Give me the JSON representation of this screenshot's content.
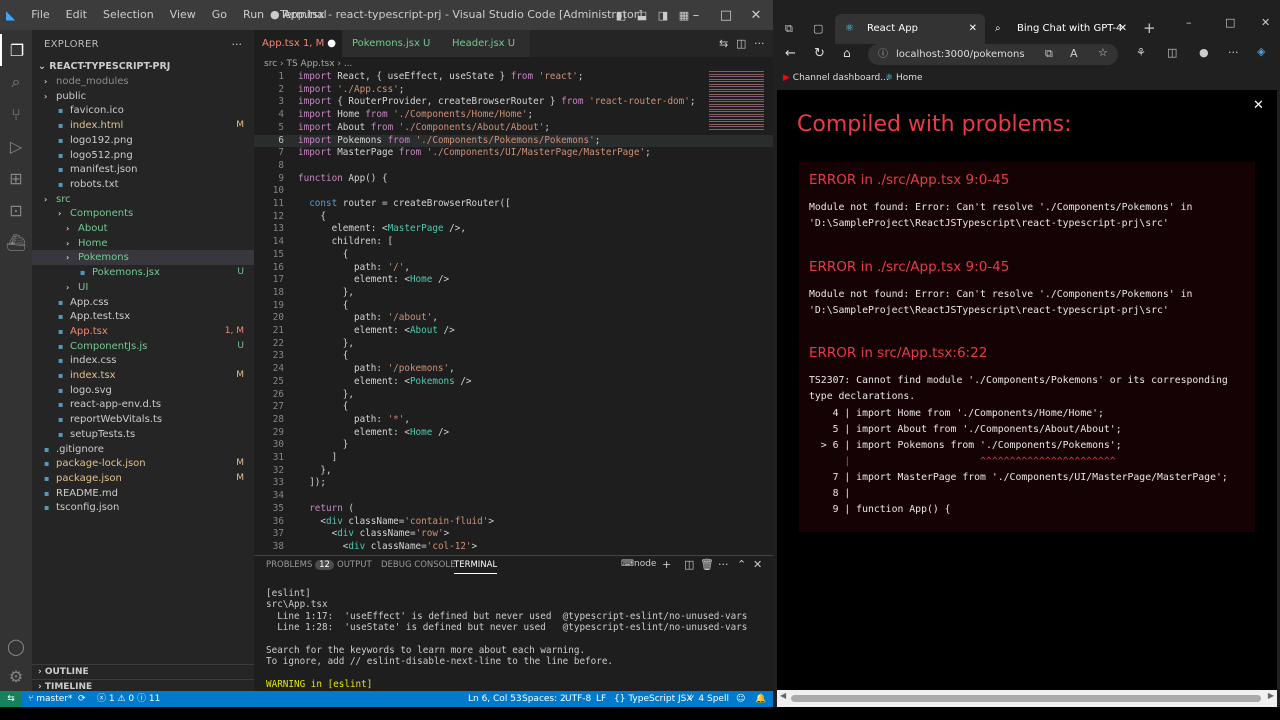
{
  "vscode": {
    "menu": [
      "File",
      "Edit",
      "Selection",
      "View",
      "Go",
      "Run",
      "Terminal"
    ],
    "window_title": "● App.tsx - react-typescript-prj - Visual Studio Code [Administrator]",
    "explorer_title": "EXPLORER",
    "project": "REACT-TYPESCRIPT-PRJ",
    "tree": [
      {
        "name": "node_modules",
        "badge": "",
        "color": "#8c8c8c",
        "kind": "folder"
      },
      {
        "name": "public",
        "badge": "",
        "color": "#ccc",
        "kind": "folder"
      },
      {
        "name": "favicon.ico",
        "badge": "",
        "color": "#ccc",
        "kind": "file"
      },
      {
        "name": "index.html",
        "badge": "M",
        "color": "#e2c08d",
        "kind": "file"
      },
      {
        "name": "logo192.png",
        "badge": "",
        "color": "#ccc",
        "kind": "file"
      },
      {
        "name": "logo512.png",
        "badge": "",
        "color": "#ccc",
        "kind": "file"
      },
      {
        "name": "manifest.json",
        "badge": "",
        "color": "#ccc",
        "kind": "file"
      },
      {
        "name": "robots.txt",
        "badge": "",
        "color": "#ccc",
        "kind": "file"
      },
      {
        "name": "src",
        "badge": "",
        "color": "#73c991",
        "kind": "folder"
      },
      {
        "name": "Components",
        "badge": "",
        "color": "#73c991",
        "kind": "folder"
      },
      {
        "name": "About",
        "badge": "",
        "color": "#73c991",
        "kind": "folder"
      },
      {
        "name": "Home",
        "badge": "",
        "color": "#73c991",
        "kind": "folder"
      },
      {
        "name": "Pokemons",
        "badge": "",
        "color": "#73c991",
        "kind": "folder"
      },
      {
        "name": "Pokemons.jsx",
        "badge": "U",
        "color": "#73c991",
        "kind": "file"
      },
      {
        "name": "UI",
        "badge": "",
        "color": "#73c991",
        "kind": "folder"
      },
      {
        "name": "App.css",
        "badge": "",
        "color": "#ccc",
        "kind": "file"
      },
      {
        "name": "App.test.tsx",
        "badge": "",
        "color": "#ccc",
        "kind": "file"
      },
      {
        "name": "App.tsx",
        "badge": "1, M",
        "color": "#f48771",
        "kind": "file"
      },
      {
        "name": "ComponentJs.js",
        "badge": "U",
        "color": "#73c991",
        "kind": "file"
      },
      {
        "name": "index.css",
        "badge": "",
        "color": "#ccc",
        "kind": "file"
      },
      {
        "name": "index.tsx",
        "badge": "M",
        "color": "#e2c08d",
        "kind": "file"
      },
      {
        "name": "logo.svg",
        "badge": "",
        "color": "#ccc",
        "kind": "file"
      },
      {
        "name": "react-app-env.d.ts",
        "badge": "",
        "color": "#ccc",
        "kind": "file"
      },
      {
        "name": "reportWebVitals.ts",
        "badge": "",
        "color": "#ccc",
        "kind": "file"
      },
      {
        "name": "setupTests.ts",
        "badge": "",
        "color": "#ccc",
        "kind": "file"
      },
      {
        "name": ".gitignore",
        "badge": "",
        "color": "#ccc",
        "kind": "file"
      },
      {
        "name": "package-lock.json",
        "badge": "M",
        "color": "#e2c08d",
        "kind": "file"
      },
      {
        "name": "package.json",
        "badge": "M",
        "color": "#e2c08d",
        "kind": "file"
      },
      {
        "name": "README.md",
        "badge": "",
        "color": "#ccc",
        "kind": "file"
      },
      {
        "name": "tsconfig.json",
        "badge": "",
        "color": "#ccc",
        "kind": "file"
      }
    ],
    "outline": "OUTLINE",
    "timeline": "TIMELINE",
    "tabs": [
      {
        "label": "App.tsx 1, M",
        "color": "#f48771"
      },
      {
        "label": "Pokemons.jsx U",
        "color": "#73c991"
      },
      {
        "label": "Header.jsx U",
        "color": "#73c991"
      }
    ],
    "breadcrumb": "src › TS App.tsx › ...",
    "code": [
      "import React, { useEffect, useState } from 'react';",
      "import './App.css';",
      "import { RouterProvider, createBrowserRouter } from 'react-router-dom';",
      "import Home from './Components/Home/Home';",
      "import About from './Components/About/About';",
      "import Pokemons from './Components/Pokemons/Pokemons';",
      "import MasterPage from './Components/UI/MasterPage/MasterPage';",
      "",
      "function App() {",
      "",
      "  const router = createBrowserRouter([",
      "    {",
      "      element: <MasterPage />,",
      "      children: [",
      "        {",
      "          path: '/',",
      "          element: <Home />",
      "        },",
      "        {",
      "          path: '/about',",
      "          element: <About />",
      "        },",
      "        {",
      "          path: '/pokemons',",
      "          element: <Pokemons />",
      "        },",
      "        {",
      "          path: '*',",
      "          element: <Home />",
      "        }",
      "      ]",
      "    },",
      "  ]);",
      "",
      "  return (",
      "    <div className='contain-fluid'>",
      "      <div className='row'>",
      "        <div className='col-12'>"
    ],
    "panel_tabs": [
      "PROBLEMS",
      "OUTPUT",
      "DEBUG CONSOLE",
      "TERMINAL"
    ],
    "problems_count": "12",
    "terminal_kind": "node",
    "terminal": [
      "[eslint]",
      "src\\App.tsx",
      "  Line 1:17:  'useEffect' is defined but never used  @typescript-eslint/no-unused-vars",
      "  Line 1:28:  'useState' is defined but never used   @typescript-eslint/no-unused-vars",
      "",
      "Search for the keywords to learn more about each warning.",
      "To ignore, add // eslint-disable-next-line to the line before.",
      "",
      "WARNING in [eslint]"
    ],
    "status": {
      "branch": "master*",
      "errors": "1",
      "warnings": "0",
      "info": "11",
      "position": "Ln 6, Col 53",
      "spaces": "Spaces: 2",
      "encoding": "UTF-8",
      "eol": "LF",
      "language": "TypeScript JSX",
      "spell": "4 Spell"
    }
  },
  "edge": {
    "tabs": [
      "React App",
      "Bing Chat with GPT-4"
    ],
    "url": "localhost:3000/pokemons",
    "favorites": [
      "Channel dashboard...",
      "Home"
    ],
    "overlay": {
      "title": "Compiled with problems:",
      "errors": [
        {
          "heading": "ERROR in ./src/App.tsx 9:0-45",
          "message": "Module not found: Error: Can't resolve './Components/Pokemons' in\n'D:\\SampleProject\\ReactJSTypescript\\react-typescript-prj\\src'"
        },
        {
          "heading": "ERROR in ./src/App.tsx 9:0-45",
          "message": "Module not found: Error: Can't resolve './Components/Pokemons' in\n'D:\\SampleProject\\ReactJSTypescript\\react-typescript-prj\\src'"
        },
        {
          "heading": "ERROR in src/App.tsx:6:22",
          "message": "TS2307: Cannot find module './Components/Pokemons' or its corresponding\ntype declarations."
        }
      ],
      "snippet": [
        "    4 | import Home from './Components/Home/Home';",
        "    5 | import About from './Components/About/About';",
        "  > 6 | import Pokemons from './Components/Pokemons';",
        "      |                      ^^^^^^^^^^^^^^^^^^^^^^^",
        "    7 | import MasterPage from './Components/UI/MasterPage/MasterPage';",
        "    8 |",
        "    9 | function App() {"
      ]
    }
  }
}
